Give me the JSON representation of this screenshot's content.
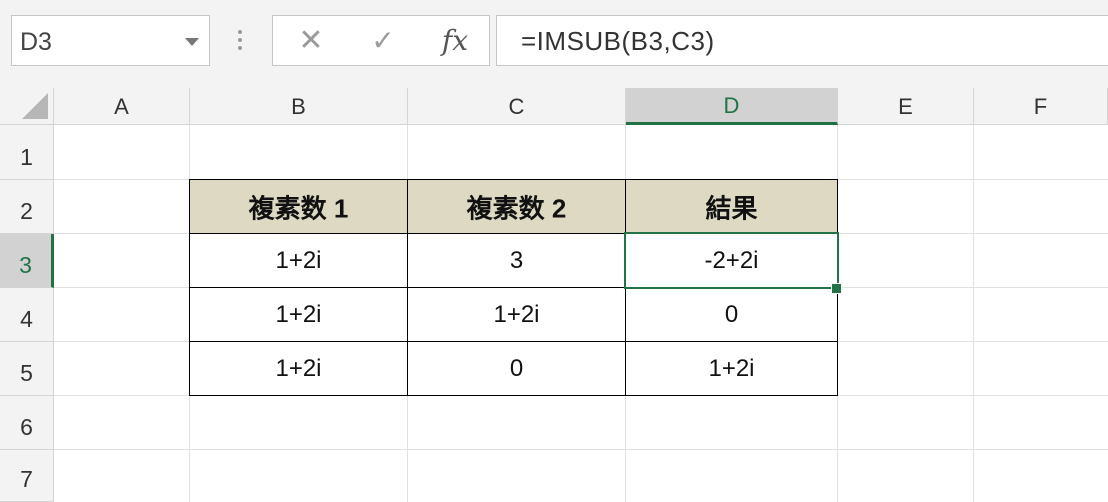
{
  "name_box": {
    "value": "D3"
  },
  "formula_bar": {
    "cancel_glyph": "✕",
    "enter_glyph": "✓",
    "fx_label": "fx",
    "formula": "=IMSUB(B3,C3)"
  },
  "columns": [
    "A",
    "B",
    "C",
    "D",
    "E",
    "F"
  ],
  "rows": [
    "1",
    "2",
    "3",
    "4",
    "5",
    "6",
    "7"
  ],
  "selected": {
    "column": "D",
    "row": "3"
  },
  "table": {
    "headers": [
      "複素数 1",
      "複素数 2",
      "結果"
    ],
    "header_fill": "#ddd9c3",
    "rows": [
      [
        "1+2i",
        "3",
        "-2+2i"
      ],
      [
        "1+2i",
        "1+2i",
        "0"
      ],
      [
        "1+2i",
        "0",
        "1+2i"
      ]
    ]
  },
  "accent_color": "#217346"
}
